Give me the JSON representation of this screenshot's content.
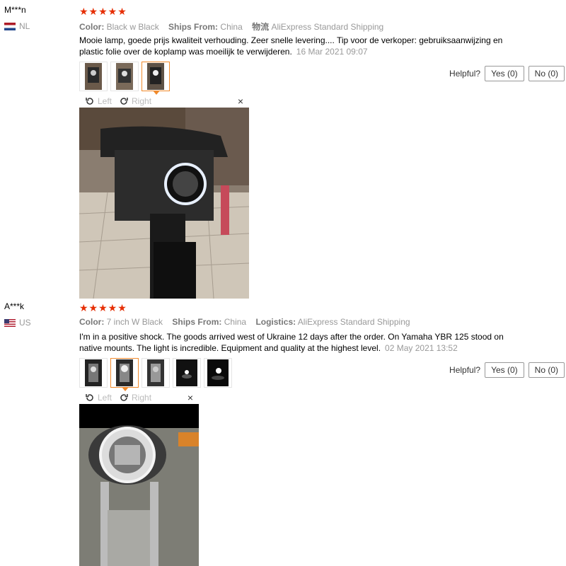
{
  "reviews": [
    {
      "user": "M***n",
      "country": "NL",
      "stars": "★★★★★",
      "color_label": "Color:",
      "color_value": "Black w Black",
      "ships_label": "Ships From:",
      "ships_value": "China",
      "logistics_label": "物流",
      "logistics_value": "AliExpress Standard Shipping",
      "text": "Mooie lamp, goede prijs kwaliteit verhouding. Zeer snelle levering.... Tip voor de verkoper: gebruiksaanwijzing en plastic folie over de koplamp was moeilijk te verwijderen.",
      "date": "16 Mar 2021 09:07",
      "helpful_label": "Helpful?",
      "yes_label": "Yes (0)",
      "no_label": "No (0)",
      "rotate_left": "Left",
      "rotate_right": "Right",
      "close": "×"
    },
    {
      "user": "A***k",
      "country": "US",
      "stars": "★★★★★",
      "color_label": "Color:",
      "color_value": "7 inch W Black",
      "ships_label": "Ships From:",
      "ships_value": "China",
      "logistics_label": "Logistics:",
      "logistics_value": "AliExpress Standard Shipping",
      "text": "I'm in a positive shock. The goods arrived west of Ukraine 12 days after the order. On Yamaha YBR 125 stood on native mounts. The light is incredible. Equipment and quality at the highest level.",
      "date": "02 May 2021 13:52",
      "helpful_label": "Helpful?",
      "yes_label": "Yes (0)",
      "no_label": "No (0)",
      "rotate_left": "Left",
      "rotate_right": "Right",
      "close": "×"
    }
  ],
  "colors": {
    "star": "#e62e04",
    "active_thumb": "#f08a2c",
    "muted": "#999999"
  }
}
